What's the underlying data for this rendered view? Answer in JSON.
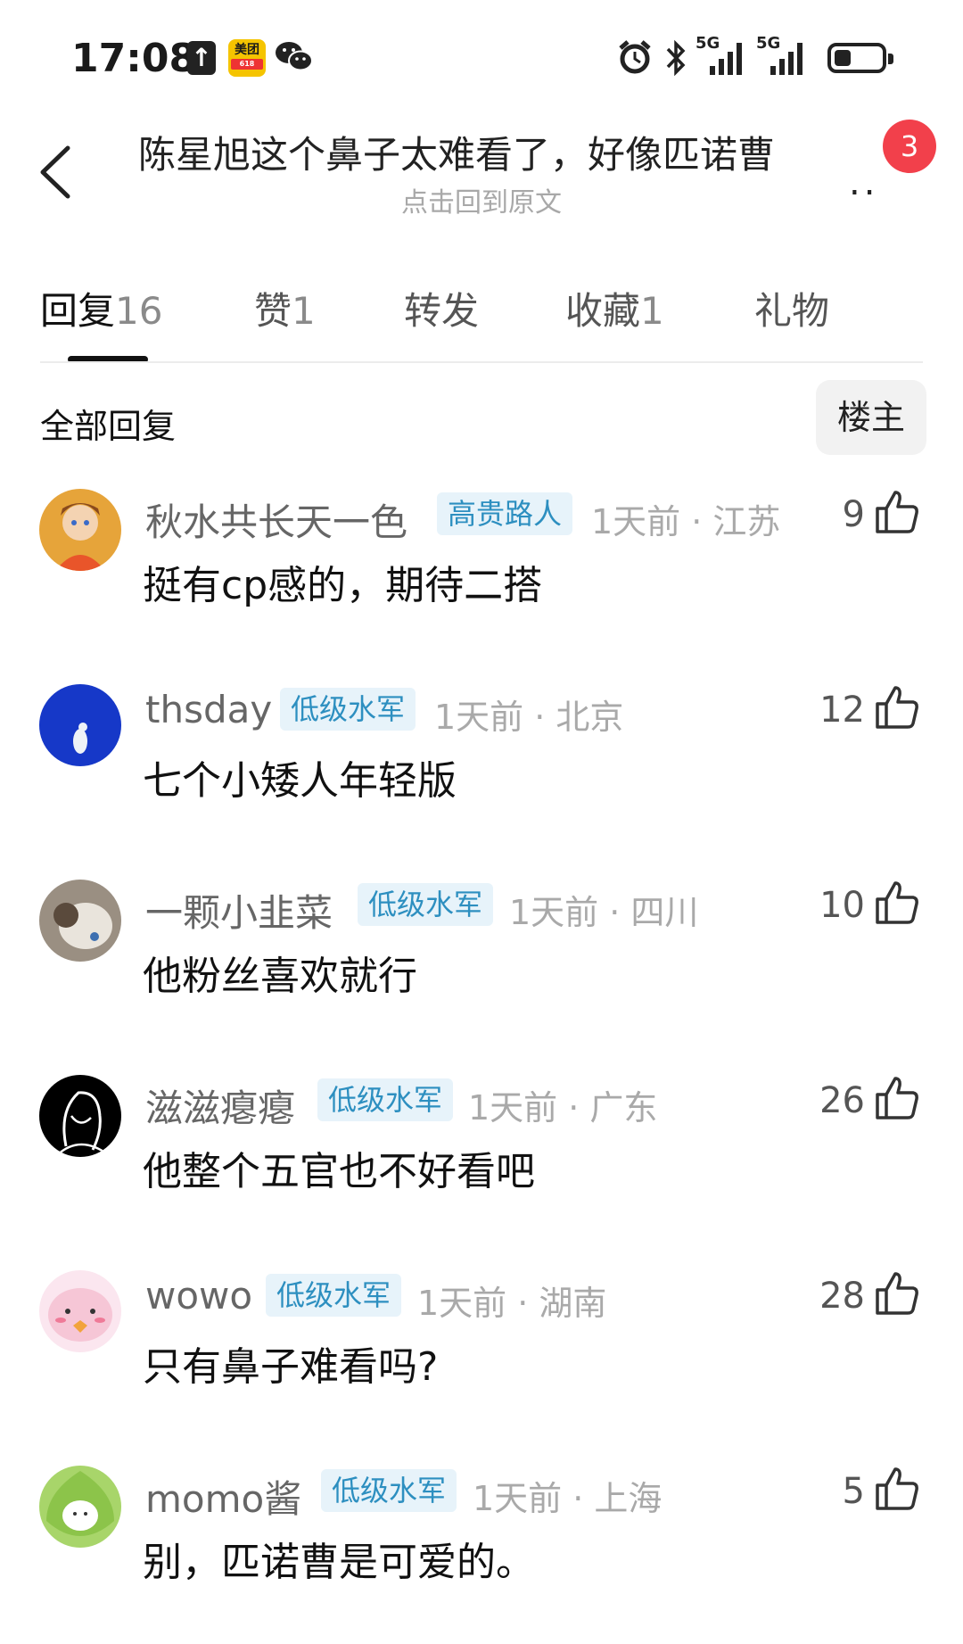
{
  "status_bar": {
    "time": "17:08",
    "icons": [
      "upload-icon",
      "meituan-app-icon",
      "wechat-icon",
      "alarm-icon",
      "bluetooth-icon",
      "signal-5g-icon",
      "signal-5g-icon",
      "battery-icon"
    ],
    "meituan_label": "美团",
    "meituan_sub": "618",
    "sim1_label": "5G",
    "sim2_label": "5G",
    "battery_level": 0.35
  },
  "header": {
    "title": "陈星旭这个鼻子太难看了，好像匹诺曹",
    "subtitle": "点击回到原文",
    "more": "..",
    "badge_count": "3"
  },
  "tabs": [
    {
      "label": "回复",
      "count": "16"
    },
    {
      "label": "赞",
      "count": "1"
    },
    {
      "label": "转发",
      "count": ""
    },
    {
      "label": "收藏",
      "count": "1"
    },
    {
      "label": "礼物",
      "count": ""
    }
  ],
  "filter": {
    "label": "全部回复",
    "owner_button": "楼主"
  },
  "comments": [
    {
      "username": "秋水共长天一色",
      "tag": "高贵路人",
      "meta": "1天前 · 江苏",
      "likes": "9",
      "text": "挺有cp感的，期待二搭"
    },
    {
      "username": "thsday",
      "tag": "低级水军",
      "meta": "1天前 · 北京",
      "likes": "12",
      "text": "七个小矮人年轻版"
    },
    {
      "username": "一颗小韭菜",
      "tag": "低级水军",
      "meta": "1天前 · 四川",
      "likes": "10",
      "text": "他粉丝喜欢就行"
    },
    {
      "username": "滋滋瘪瘪",
      "tag": "低级水军",
      "meta": "1天前 · 广东",
      "likes": "26",
      "text": "他整个五官也不好看吧"
    },
    {
      "username": "wowo",
      "tag": "低级水军",
      "meta": "1天前 · 湖南",
      "likes": "28",
      "text": "只有鼻子难看吗?"
    },
    {
      "username": "momo酱",
      "tag": "低级水军",
      "meta": "1天前 · 上海",
      "likes": "5",
      "text": "别，匹诺曹是可爱的。"
    }
  ],
  "colors": {
    "tag_bg": "#e7f3fa",
    "tag_text": "#2d8fc0",
    "badge": "#f2404b"
  }
}
